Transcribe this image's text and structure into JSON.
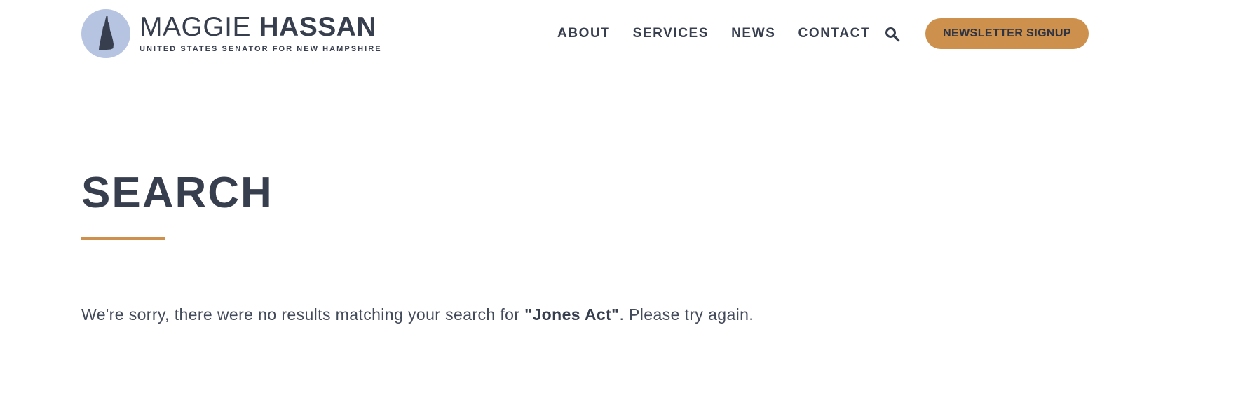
{
  "header": {
    "logo": {
      "first_name": "MAGGIE",
      "last_name": "HASSAN",
      "tagline": "UNITED STATES SENATOR FOR NEW HAMPSHIRE"
    },
    "nav": [
      {
        "label": "ABOUT"
      },
      {
        "label": "SERVICES"
      },
      {
        "label": "NEWS"
      },
      {
        "label": "CONTACT"
      }
    ],
    "search_icon": "search-icon",
    "signup_label": "NEWSLETTER SIGNUP"
  },
  "main": {
    "title": "SEARCH",
    "message_prefix": "We're sorry, there were no results matching your search for ",
    "query": "\"Jones Act\"",
    "message_suffix": ". Please try again."
  },
  "colors": {
    "text": "#373e4e",
    "accent": "#cd914d",
    "seal": "#b6c4e2"
  }
}
